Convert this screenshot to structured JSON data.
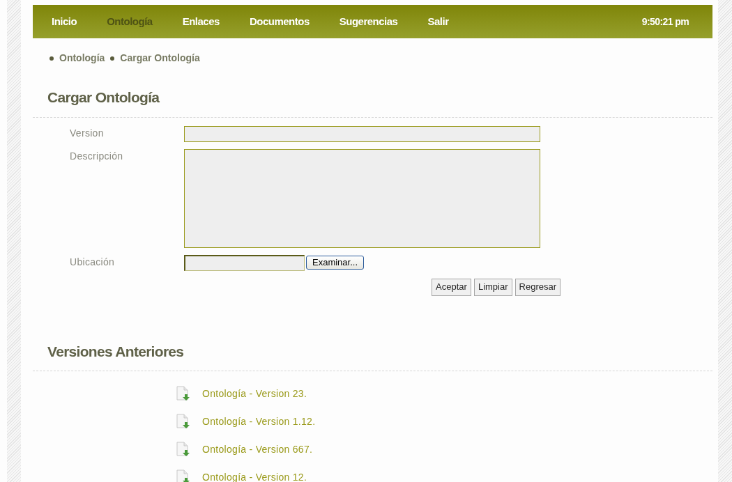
{
  "nav": {
    "items": [
      {
        "label": "Inicio",
        "selected": false
      },
      {
        "label": "Ontología",
        "selected": true
      },
      {
        "label": "Enlaces",
        "selected": false
      },
      {
        "label": "Documentos",
        "selected": false
      },
      {
        "label": "Sugerencias",
        "selected": false
      },
      {
        "label": "Salir",
        "selected": false
      }
    ],
    "clock": "9:50:21 pm"
  },
  "breadcrumb": [
    "Ontología",
    "Cargar Ontología"
  ],
  "form": {
    "title": "Cargar Ontología",
    "fields": [
      {
        "label": "Version",
        "kind": "text"
      },
      {
        "label": "Descripción",
        "kind": "textarea"
      },
      {
        "label": "Ubicación",
        "kind": "file",
        "button": "Examinar..."
      }
    ],
    "buttons": [
      "Aceptar",
      "Limpiar",
      "Regresar"
    ]
  },
  "versions": {
    "title": "Versiones Anteriores",
    "items": [
      "Ontología - Version 23.",
      "Ontología - Version 1.12.",
      "Ontología - Version 667.",
      "Ontología - Version 12."
    ]
  }
}
